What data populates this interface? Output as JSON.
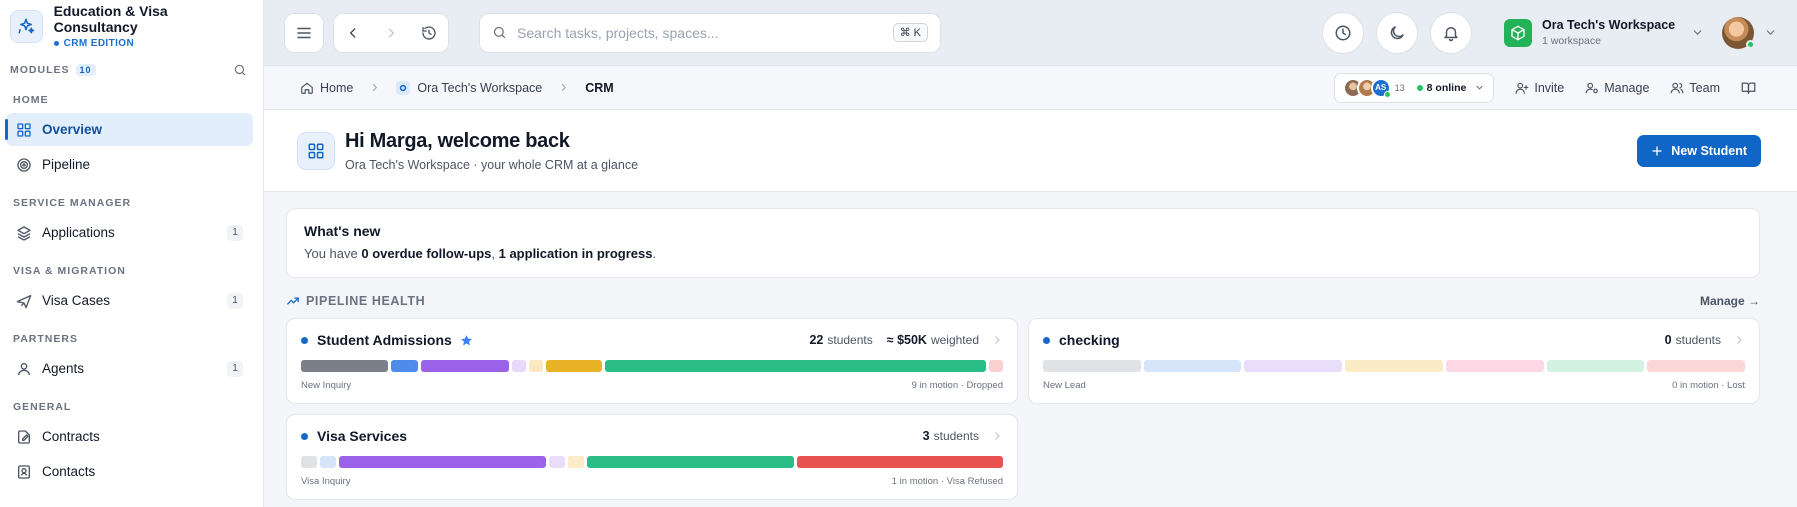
{
  "brand": {
    "title": "Education & Visa Consultancy",
    "subtitle": "CRM EDITION"
  },
  "sidebar": {
    "modules_label": "MODULES",
    "modules_count": "10",
    "sections": {
      "home": "HOME",
      "service_manager": "SERVICE MANAGER",
      "visa_migration": "VISA & MIGRATION",
      "partners": "PARTNERS",
      "general": "GENERAL"
    },
    "items": {
      "overview": {
        "label": "Overview"
      },
      "pipeline": {
        "label": "Pipeline"
      },
      "applications": {
        "label": "Applications",
        "badge": "1"
      },
      "visa_cases": {
        "label": "Visa Cases",
        "badge": "1"
      },
      "agents": {
        "label": "Agents",
        "badge": "1"
      },
      "contracts": {
        "label": "Contracts"
      },
      "contacts": {
        "label": "Contacts"
      }
    }
  },
  "topbar": {
    "search_placeholder": "Search tasks, projects, spaces...",
    "search_shortcut": "⌘ K",
    "workspace_name": "Ora Tech's Workspace",
    "workspace_count": "1 workspace"
  },
  "breadcrumb": {
    "home": "Home",
    "workspace": "Ora Tech's Workspace",
    "current": "CRM"
  },
  "presence": {
    "initials": "AS",
    "count": "13",
    "online": "8 online"
  },
  "actions": {
    "invite": "Invite",
    "manage": "Manage",
    "team": "Team"
  },
  "hero": {
    "title": "Hi Marga, welcome back",
    "subtitle": "Ora Tech's Workspace · your whole CRM at a glance",
    "new_button": "New Student"
  },
  "whats_new": {
    "title": "What's new",
    "prefix": "You have ",
    "overdue": "0 overdue follow-ups",
    "comma": ", ",
    "in_progress": "1 application in progress",
    "suffix": "."
  },
  "pipeline_health": {
    "title": "PIPELINE HEALTH",
    "manage": "Manage →",
    "cards": [
      {
        "name": "Student Admissions",
        "starred": true,
        "count": "22",
        "count_label": "students",
        "weighted": "≈ $50K",
        "weighted_label": "weighted",
        "first_stage": "New Inquiry",
        "footer_right": "9 in motion · Dropped",
        "segments": [
          {
            "color": "#7b7f87",
            "weight": 5.5
          },
          {
            "color": "#4f8bea",
            "weight": 1.7
          },
          {
            "color": "#9b63ea",
            "weight": 5.5
          },
          {
            "color": "#e8d9fb",
            "weight": 0.9
          },
          {
            "color": "#fbe8c2",
            "weight": 0.9
          },
          {
            "color": "#e8b326",
            "weight": 3.5
          },
          {
            "color": "#2bbd86",
            "weight": 24
          },
          {
            "color": "#fbd0d0",
            "weight": 0.9
          }
        ]
      },
      {
        "name": "checking",
        "starred": false,
        "count": "0",
        "count_label": "students",
        "first_stage": "New Lead",
        "footer_right": "0 in motion · Lost",
        "segments": [
          {
            "color": "#e0e1e4",
            "weight": 1
          },
          {
            "color": "#d7e5fb",
            "weight": 1
          },
          {
            "color": "#e8defb",
            "weight": 1
          },
          {
            "color": "#fbebc6",
            "weight": 1
          },
          {
            "color": "#fbd8e3",
            "weight": 1
          },
          {
            "color": "#d4f2e2",
            "weight": 1
          },
          {
            "color": "#fbd6d6",
            "weight": 1
          }
        ]
      },
      {
        "name": "Visa Services",
        "starred": false,
        "count": "3",
        "count_label": "students",
        "first_stage": "Visa Inquiry",
        "footer_right": "1 in motion · Visa Refused",
        "segments": [
          {
            "color": "#e0e1e4",
            "weight": 0.9
          },
          {
            "color": "#d7e5fb",
            "weight": 0.9
          },
          {
            "color": "#9b63ea",
            "weight": 11.5
          },
          {
            "color": "#e8defb",
            "weight": 0.9
          },
          {
            "color": "#fbebc6",
            "weight": 0.9
          },
          {
            "color": "#2bbd86",
            "weight": 11.5
          },
          {
            "color": "#ea5252",
            "weight": 11.5
          }
        ]
      }
    ]
  }
}
